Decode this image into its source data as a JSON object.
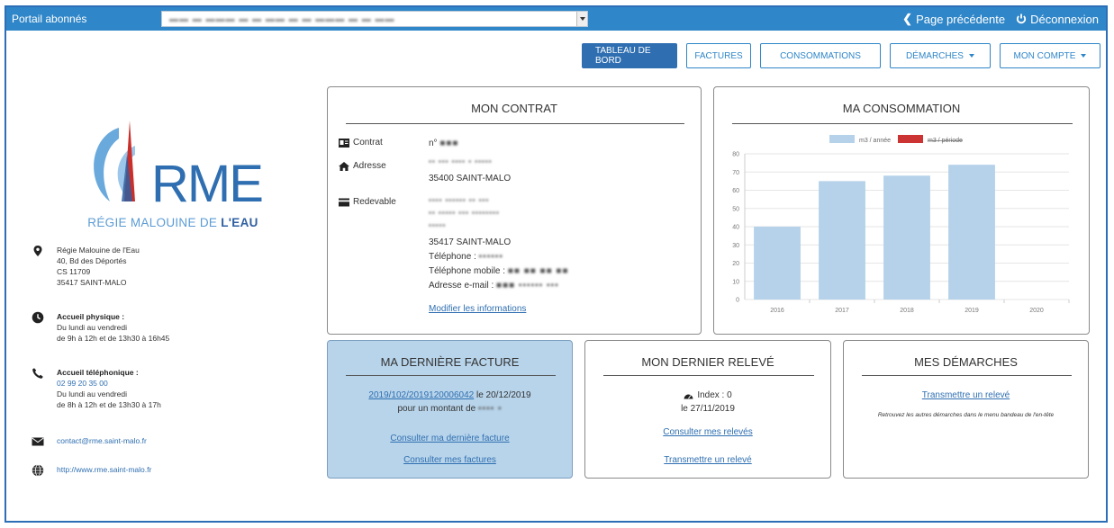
{
  "topbar": {
    "portal_label": "Portail abonnés",
    "account_select_value": "▬▬ ▬ ▬▬▬ ▬ ▬ ▬▬ ▬ ▬ ▬▬▬ ▬ ▬ ▬▬",
    "back_label": "Page précédente",
    "logout_label": "Déconnexion"
  },
  "nav": {
    "items": [
      {
        "label": "TABLEAU DE BORD",
        "active": true
      },
      {
        "label": "FACTURES"
      },
      {
        "label": "CONSOMMATIONS"
      },
      {
        "label": "DÉMARCHES",
        "dropdown": true
      },
      {
        "label": "MON COMPTE",
        "dropdown": true
      }
    ]
  },
  "logo": {
    "brand": "RME",
    "subtitle_a": "RÉGIE MALOUINE DE ",
    "subtitle_b": "L'EAU"
  },
  "sidebar": {
    "address": [
      "Régie Malouine de l'Eau",
      "40, Bd des Déportés",
      "CS 11709",
      "35417 SAINT-MALO"
    ],
    "physical_title": "Accueil physique :",
    "physical_lines": [
      "Du lundi au vendredi",
      "de 9h à 12h et de 13h30 à 16h45"
    ],
    "phone_title": "Accueil téléphonique :",
    "phone_number": "02 99 20 35 00",
    "phone_lines": [
      "Du lundi au vendredi",
      "de 8h à 12h et de 13h30 à 17h"
    ],
    "email": "contact@rme.saint-malo.fr",
    "website": "http://www.rme.saint-malo.fr"
  },
  "contrat": {
    "title": "MON CONTRAT",
    "contrat_label": "Contrat",
    "contrat_value": "n°",
    "adresse_label": "Adresse",
    "adresse_line1": "▪▪ ▪▪▪ ▪▪▪▪ ▪ ▪▪▪▪▪",
    "adresse_line2": "35400 SAINT-MALO",
    "redevable_label": "Redevable",
    "redevable_line1": "▪▪▪▪ ▪▪▪▪▪▪ ▪▪ ▪▪▪",
    "redevable_line2": "▪▪ ▪▪▪▪▪ ▪▪▪ ▪▪▪▪▪▪▪▪",
    "redevable_line3": "▪▪▪▪▪",
    "redevable_city": "35417 SAINT-MALO",
    "telephone": "Téléphone :",
    "mobile": "Téléphone mobile :",
    "email": "Adresse e-mail :",
    "modify_link": "Modifier les informations"
  },
  "consommation": {
    "title": "MA CONSOMMATION",
    "legend_a": "m3 / année",
    "legend_b": "m3 / période"
  },
  "chart_data": {
    "type": "bar",
    "categories": [
      "2016",
      "2017",
      "2018",
      "2019",
      "2020"
    ],
    "series": [
      {
        "name": "m3 / année",
        "values": [
          40,
          65,
          68,
          74,
          0
        ],
        "color": "#b5d2ea"
      },
      {
        "name": "m3 / période",
        "values": [
          0,
          0,
          0,
          0,
          0
        ],
        "color": "#cc3333"
      }
    ],
    "ylim": [
      0,
      80
    ],
    "yticks": [
      0,
      10,
      20,
      30,
      40,
      50,
      60,
      70,
      80
    ],
    "legend": "top",
    "grid": true
  },
  "facture": {
    "title": "MA DERNIÈRE FACTURE",
    "ref_link": "2019/102/2019120006042",
    "date_text": " le 20/12/2019",
    "amount_text": "pour un montant de",
    "last_link": "Consulter ma dernière facture",
    "all_link": "Consulter mes factures"
  },
  "releve": {
    "title": "MON DERNIER RELEVÉ",
    "index_text": "Index : 0",
    "date_text": "le 27/11/2019",
    "consult_link": "Consulter mes relevés",
    "transmit_link": "Transmettre un relevé"
  },
  "demarches": {
    "title": "MES DÉMARCHES",
    "transmit_link": "Transmettre un relevé",
    "note": "Retrouvez les autres démarches dans le menu bandeau de l'en-tête"
  }
}
